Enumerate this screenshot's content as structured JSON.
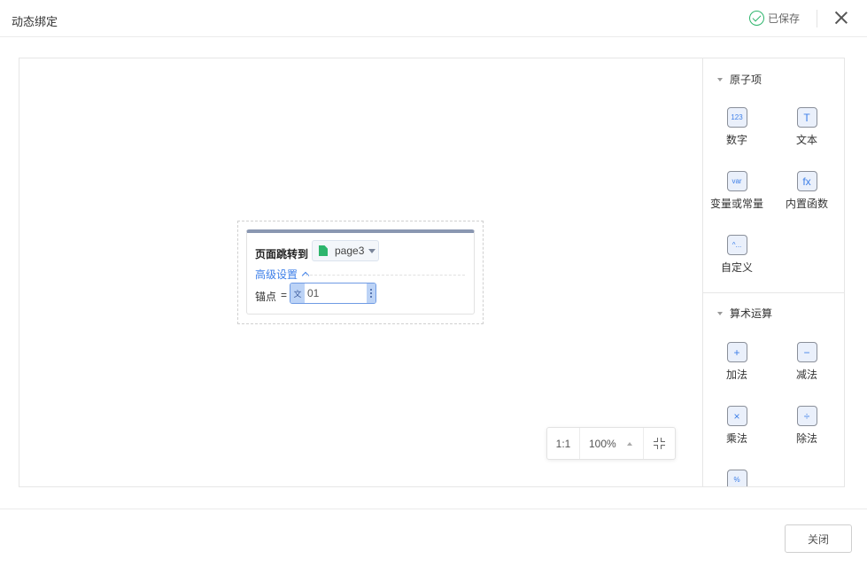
{
  "dialog": {
    "title": "动态绑定",
    "saved_label": "已保存"
  },
  "node": {
    "action_label": "页面跳转到",
    "page_value": "page3",
    "advanced_label": "高级设置",
    "anchor_label": "锚点",
    "equals": "=",
    "anchor_type_tag": "文",
    "anchor_value": "01"
  },
  "zoom": {
    "one_to_one": "1:1",
    "percent": "100%"
  },
  "panel": {
    "atom_section": "原子项",
    "atom_items": [
      {
        "label": "数字",
        "icon_text": "123",
        "icon": "number-icon"
      },
      {
        "label": "文本",
        "icon_text": "T",
        "icon": "text-icon"
      },
      {
        "label": "变量或常量",
        "icon_text": "var",
        "icon": "variable-icon"
      },
      {
        "label": "内置函数",
        "icon_text": "fx",
        "icon": "function-icon"
      },
      {
        "label": "自定义",
        "icon_text": "^...",
        "icon": "custom-icon"
      }
    ],
    "math_section": "算术运算",
    "math_items": [
      {
        "label": "加法",
        "icon_text": "+",
        "icon": "plus-icon"
      },
      {
        "label": "减法",
        "icon_text": "−",
        "icon": "minus-icon"
      },
      {
        "label": "乘法",
        "icon_text": "×",
        "icon": "multiply-icon"
      },
      {
        "label": "除法",
        "icon_text": "÷",
        "icon": "divide-icon"
      },
      {
        "label": "",
        "icon_text": "%",
        "icon": "percent-icon"
      }
    ]
  },
  "footer": {
    "close_label": "关闭"
  },
  "colors": {
    "accent": "#3d7fe8",
    "saved_green": "#2db56c",
    "node_header": "#8a97b1"
  }
}
